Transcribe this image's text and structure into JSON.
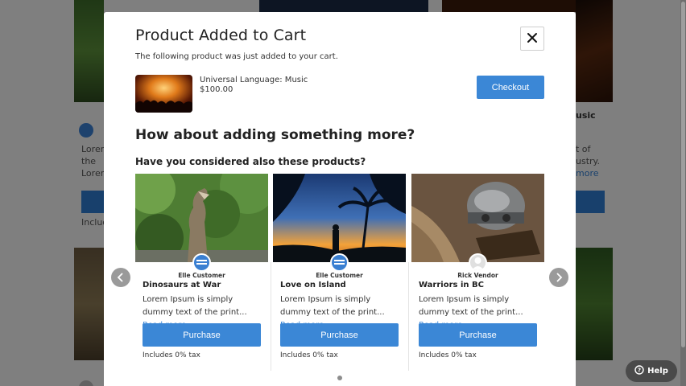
{
  "modal": {
    "title": "Product Added to Cart",
    "subtitle": "The following product was just added to your cart.",
    "close_icon": "close-icon"
  },
  "added_product": {
    "name": "Universal Language: Music",
    "price": "$100.00",
    "checkout_label": "Checkout"
  },
  "upsell": {
    "heading": "How about adding something more?",
    "subheading": "Have you considered also these products?"
  },
  "products": [
    {
      "author": "Elle Customer",
      "title": "Dinosaurs at War",
      "desc": "Lorem Ipsum is simply dummy text of the print...",
      "read_more": "Read more",
      "purchase_label": "Purchase",
      "tax": "Includes 0% tax",
      "avatar": "brand-logo-icon"
    },
    {
      "author": "Elle Customer",
      "title": "Love on Island",
      "desc": "Lorem Ipsum is simply dummy text of the print...",
      "read_more": "Read more",
      "purchase_label": "Purchase",
      "tax": "Includes 0% tax",
      "avatar": "brand-logo-icon"
    },
    {
      "author": "Rick Vendor",
      "title": "Warriors in BC",
      "desc": "Lorem Ipsum is simply dummy text of the print...",
      "read_more": "Read more",
      "purchase_label": "Purchase",
      "tax": "Includes 0% tax",
      "avatar": "user-placeholder-icon"
    }
  ],
  "background": {
    "fragments": [
      "Lorem",
      "the",
      "Lorem",
      "Include",
      "usic",
      "t of",
      "ustry.",
      "more"
    ]
  },
  "help": {
    "label": "Help"
  },
  "colors": {
    "accent": "#3b87d6",
    "overlay": "rgba(0,0,0,0.48)"
  }
}
